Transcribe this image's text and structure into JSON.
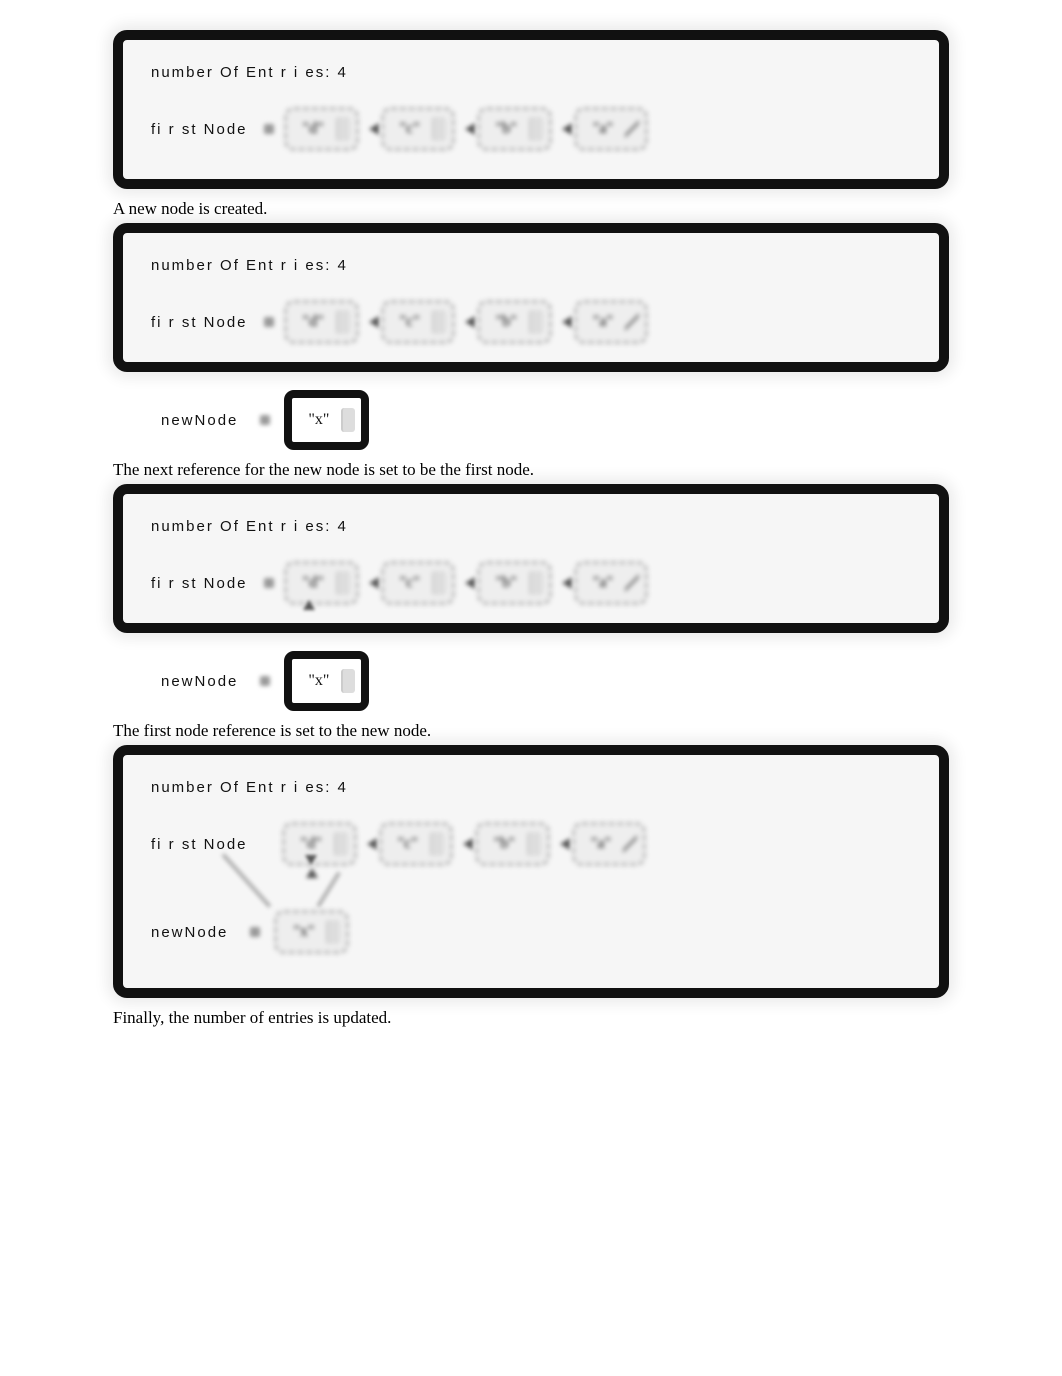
{
  "step1": {
    "entries_label": "number Of Ent r i es: 4",
    "first_label": "fi r st Node",
    "nodes": [
      "\"d\"",
      "\"c\"",
      "\"b\"",
      "\"a\""
    ]
  },
  "caption1": "A new node is created.",
  "step2": {
    "entries_label": "number Of Ent r i es: 4",
    "first_label": "fi r st Node",
    "nodes": [
      "\"d\"",
      "\"c\"",
      "\"b\"",
      "\"a\""
    ],
    "new_label": "newNode",
    "new_val": "\"x\""
  },
  "caption2": "The next reference for the new node is set to be the first node.",
  "step3": {
    "entries_label": "number Of Ent r i es: 4",
    "first_label": "fi r st Node",
    "nodes": [
      "\"d\"",
      "\"c\"",
      "\"b\"",
      "\"a\""
    ],
    "new_label": "newNode",
    "new_val": "\"x\""
  },
  "caption3": "The first node reference is set to the new node.",
  "step4": {
    "entries_label": "number Of Ent r i es: 4",
    "first_label": "fi r st Node",
    "nodes": [
      "\"d\"",
      "\"c\"",
      "\"b\"",
      "\"a\""
    ],
    "new_label": "newNode",
    "new_val": "\"x\""
  },
  "caption4": "Finally, the number of entries is updated."
}
